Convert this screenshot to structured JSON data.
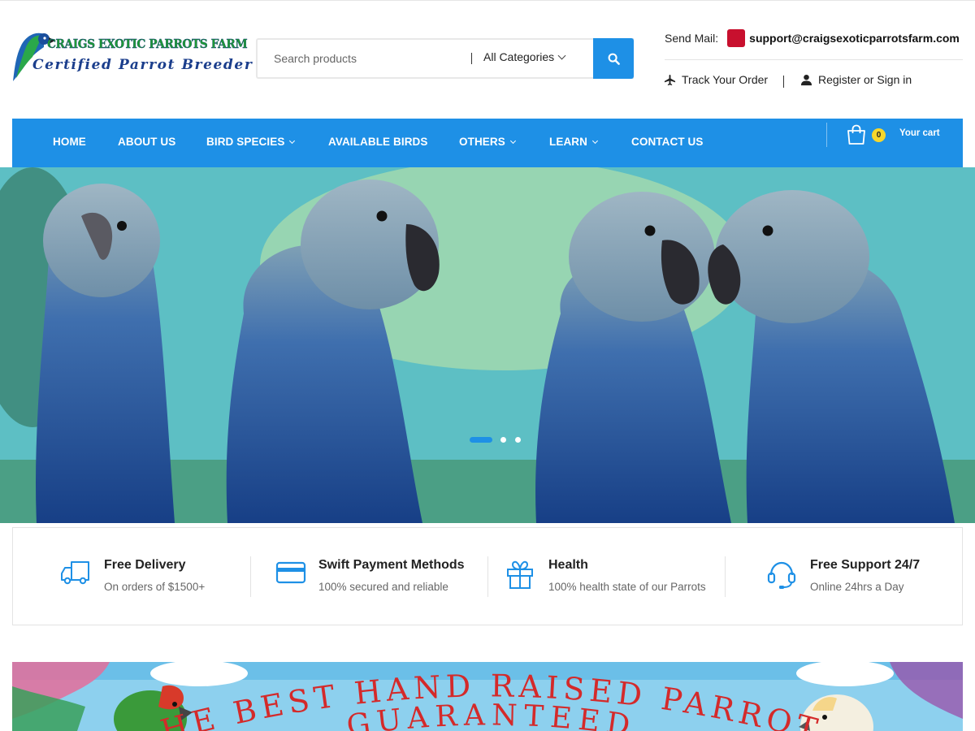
{
  "logo": {
    "line1": "CRAIGS EXOTIC PARROTS FARM",
    "line2": "Certified Parrot Breeder"
  },
  "search": {
    "placeholder": "Search products",
    "category": "All Categories"
  },
  "contact": {
    "mail_label": "Send Mail:",
    "email": "support@craigsexoticparrotsfarm.com"
  },
  "account_links": {
    "track": "Track Your Order",
    "account": "Register or Sign in"
  },
  "nav": {
    "items": [
      {
        "label": "HOME",
        "dropdown": false
      },
      {
        "label": "ABOUT US",
        "dropdown": false
      },
      {
        "label": "BIRD SPECIES",
        "dropdown": true
      },
      {
        "label": "AVAILABLE BIRDS",
        "dropdown": false
      },
      {
        "label": "OTHERS",
        "dropdown": true
      },
      {
        "label": "LEARN",
        "dropdown": true
      },
      {
        "label": "CONTACT US",
        "dropdown": false
      }
    ],
    "cart_count": "0",
    "cart_label": "Your cart"
  },
  "hero": {
    "slides": 3,
    "active_slide": 1
  },
  "features": [
    {
      "icon": "truck-icon",
      "title": "Free Delivery",
      "subtitle": "On orders of $1500+"
    },
    {
      "icon": "credit-card-icon",
      "title": "Swift Payment Methods",
      "subtitle": "100% secured and reliable"
    },
    {
      "icon": "gift-icon",
      "title": "Health",
      "subtitle": "100% health state of our Parrots"
    },
    {
      "icon": "headset-icon",
      "title": "Free Support 24/7",
      "subtitle": "Online 24hrs a Day"
    }
  ],
  "banner": {
    "headline_line1": "THE BEST HAND RAISED PARROTS",
    "headline_line2": "GUARANTEED"
  },
  "colors": {
    "accent": "#1e90e6",
    "cart_badge": "#f6d72c",
    "mail_flag": "#c8102e",
    "banner_text": "#d42a2a"
  }
}
